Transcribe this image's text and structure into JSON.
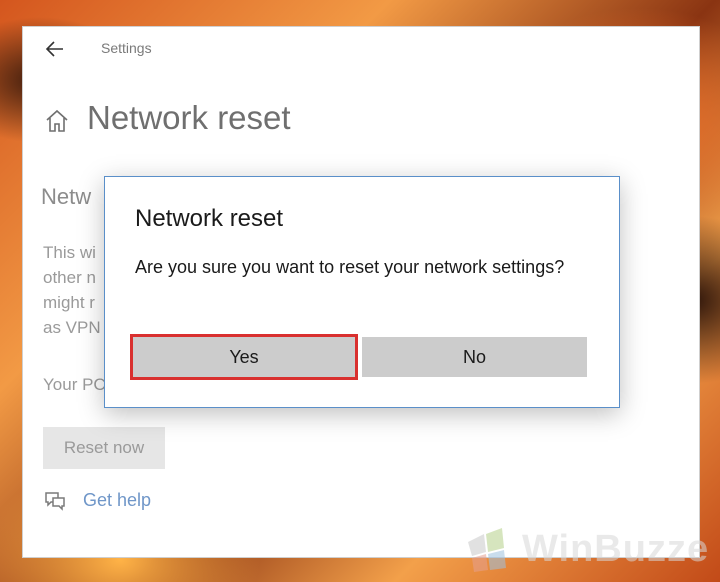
{
  "window": {
    "title": "Settings",
    "page_title": "Network reset",
    "section_heading": "Netw",
    "description_lines": [
      "This wi",
      "other n",
      "might r",
      "as VPN"
    ],
    "restart_note": "Your PC",
    "reset_button_label": "Reset now",
    "help_link": "Get help"
  },
  "dialog": {
    "title": "Network reset",
    "message": "Are you sure you want to reset your network settings?",
    "yes_label": "Yes",
    "no_label": "No",
    "highlight_color": "#d9302f"
  },
  "watermark": {
    "text": "WinBuzze"
  },
  "icons": {
    "back": "arrow-left-icon",
    "home": "home-icon",
    "help": "chat-bubble-icon",
    "logo": "winbuzzer-logo-icon"
  },
  "colors": {
    "dialog_border": "#5a8fc9",
    "link": "#6f96c8",
    "button_bg": "#cccccc"
  }
}
